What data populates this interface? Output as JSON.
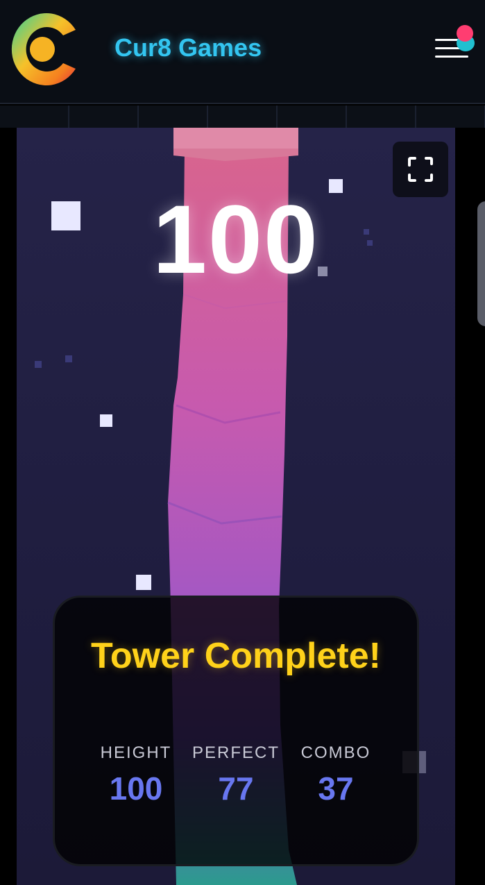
{
  "header": {
    "brand_name": "Cur8 Games",
    "logo_icon": "cur8-logo-icon",
    "menu_icon": "hamburger-menu-icon",
    "colors": {
      "brand": "#33c5f0",
      "notification": "#ff3d71"
    }
  },
  "game": {
    "score": "100",
    "fullscreen_icon": "fullscreen-icon",
    "colors": {
      "tower_top": "#e085a8",
      "tower_bottom": "#6a58d8",
      "panel_title": "#ffd21a",
      "stat_value": "#6877f0"
    }
  },
  "result": {
    "title": "Tower Complete!",
    "stats": [
      {
        "label": "HEIGHT",
        "value": "100"
      },
      {
        "label": "PERFECT",
        "value": "77"
      },
      {
        "label": "COMBO",
        "value": "37"
      }
    ]
  }
}
